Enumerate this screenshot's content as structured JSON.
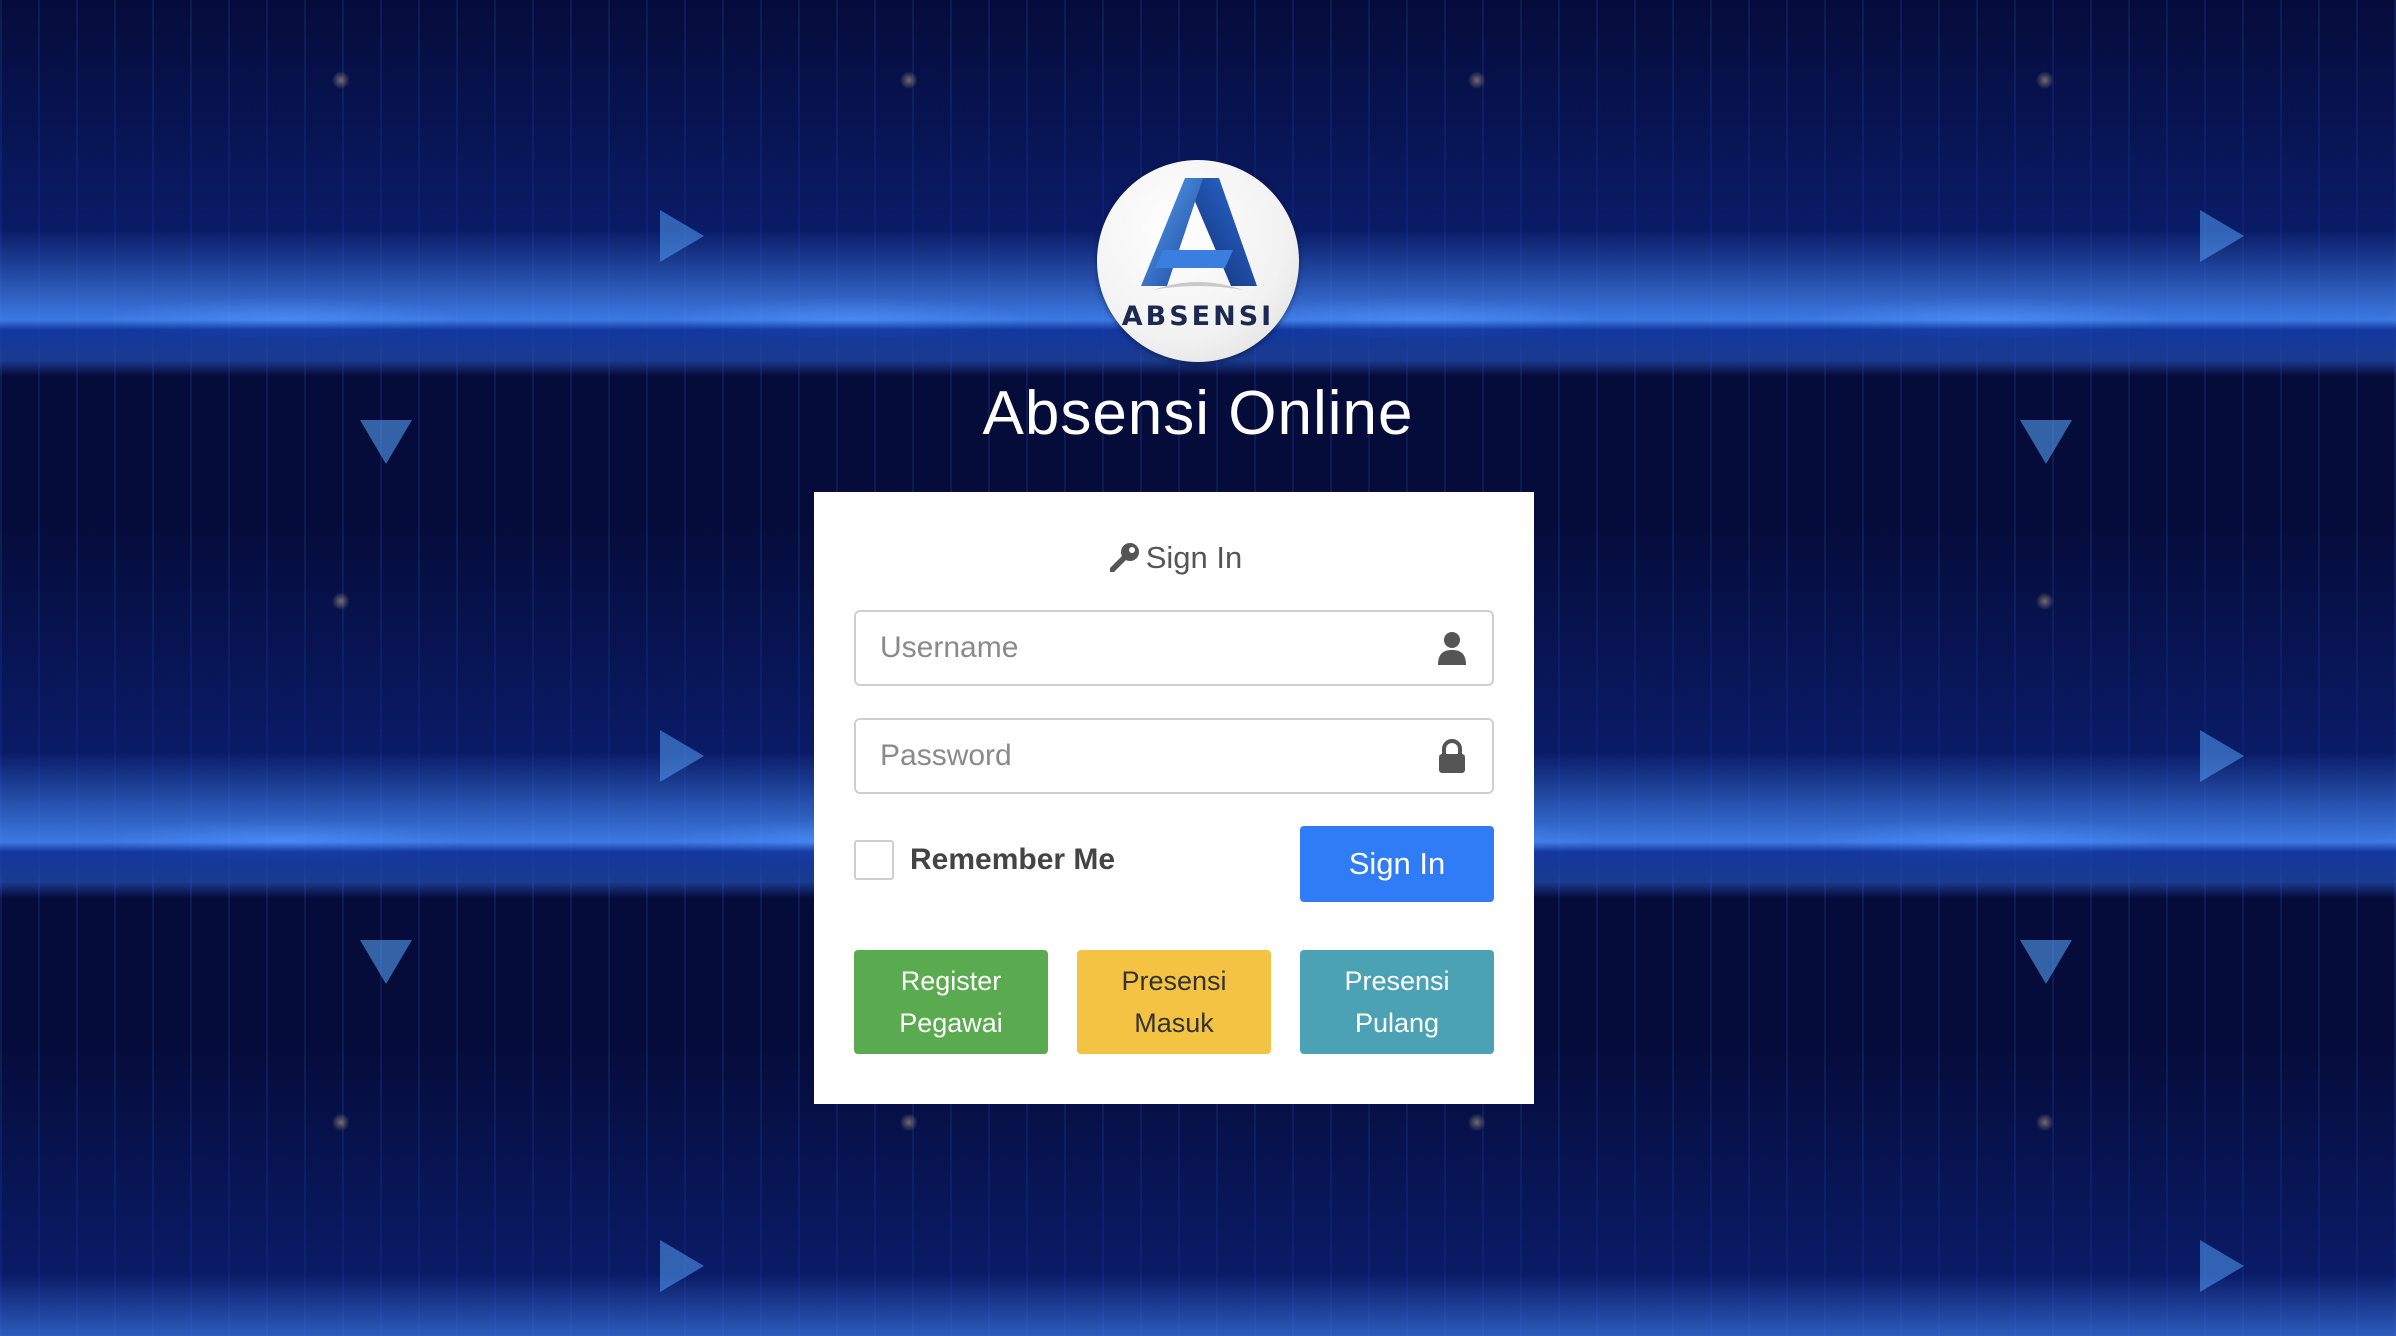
{
  "app": {
    "title": "Absensi Online",
    "logo_text": "ABSENSI"
  },
  "login": {
    "heading": "Sign In",
    "username_placeholder": "Username",
    "password_placeholder": "Password",
    "remember_label": "Remember Me",
    "submit_label": "Sign In"
  },
  "actions": {
    "register_line1": "Register",
    "register_line2": "Pegawai",
    "masuk_line1": "Presensi",
    "masuk_line2": "Masuk",
    "pulang_line1": "Presensi",
    "pulang_line2": "Pulang"
  },
  "icons": {
    "heading": "key-icon",
    "username": "user-icon",
    "password": "lock-icon"
  },
  "colors": {
    "background": "#050c3a",
    "signin_button": "#2f7cf6",
    "register_button": "#5aab4f",
    "masuk_button": "#f5c344",
    "pulang_button": "#4ba2b4"
  }
}
